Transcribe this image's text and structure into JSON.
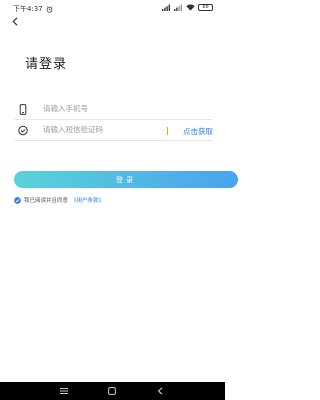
{
  "status_bar": {
    "time": "下午4:37",
    "battery": "88"
  },
  "page": {
    "title": "请登录"
  },
  "form": {
    "phone_placeholder": "请输入手机号",
    "code_placeholder": "请输入短信验证码",
    "get_code_label": "点击获取",
    "login_label": "登录"
  },
  "agreement": {
    "prefix": "我已阅读并且同意",
    "link": "《用户条款》"
  },
  "colors": {
    "accent_blue": "#2e7fe0",
    "gradient_start": "#5ad2d9",
    "gradient_end": "#4aa3ee"
  }
}
